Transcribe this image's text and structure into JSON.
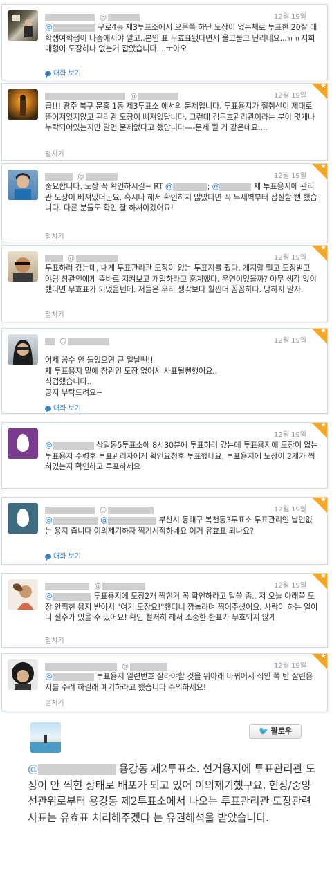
{
  "tweets": [
    {
      "time": "12월 19일",
      "text": "구로4동 제3투표소에서 오른쪽 하단 도장이 없는채로 투표한 20살 대학생여학생이 나중에서야 알고..본인 표 무효표됐다면서 울고불고 난리네요...ㅠㅠ저희 매형이 도장하나 없는거 잡았습니다....ㅜ아오",
      "action": "대화 보기"
    },
    {
      "time": "12월 19일",
      "text": "급!!! 광주 북구 문흥 1동 제3투표소 에서의 문제입니다. 투표용지가 절취선이 제대로 뜯어져있지않고 관리관 도장이 빠져있답니다. 그런데 김두호관리관이라는 분이 몇개나 누락되어있는지만 알면 문제없다고 했답니다----문제 될 거 같은데요....",
      "action": "펼치기"
    },
    {
      "time": "12월 19일",
      "prefix": "중요합니다. 도장 꼭 확인하시길~ RT",
      "text": "제 투표용지에 관리관 도장이 빠져있더군요. 혹시나 해서 확인하지 않았다면 꼭 두새벽부터 삽질할 뻔 했습니다. 다른 분들도 확인 잘 하셔야겠어요!",
      "action": "펼치기"
    },
    {
      "time": "12월 19일",
      "text": "투표하러 갔는데, 내게 투표관리관 도장이 없는 투표지를 줬다. 개지랄 떨고 도장받고 야당 참관인에게 똑바로 지켜보고 개입하라고 훈계했다. 우연이었을까? 아무 생각 없이 했다면 무효표가 되었을텐데. 저들은 우리 생각보다 훨씬더 꼼꼼하다. 당하지 말자.",
      "action": "펼치기"
    },
    {
      "time": "12월 19일",
      "lines": [
        "어제 꼼수 안 들었으면 큰 일날뻔!!",
        "제 투표용지 밑에 참관인 도장 없어서 사표될뻔했어요..",
        "식겁했습니다..",
        "공지 부탁드려요~"
      ],
      "action": "대화 보기"
    },
    {
      "time": "12월 19일",
      "text": "상일동5투표소에 8시30분에 투표하러 갔는데 투표용지에 도장이 없는 투표용지 수령후 투표관리자에게 확인요청후 투표했네요, 투표용지에 도장이 2개가 찍혀있는지 확인하고 투표하세요",
      "action": ""
    },
    {
      "time": "12월 19일",
      "text": "부산시 동래구 복천동3투표소  투표관리인 날인없는 용지 줍니다 이의제기하자 찍기시작하네요 이거 유효표 되나요?",
      "action": "대화 보기"
    },
    {
      "time": "12월 19일",
      "text": "투표용지에 도장2개 찍힌거 꼭 확인하라고 말씀 좀..  저 오늘 아래쪽 도장 안찍힌 용지 받아서  \"여기 도장요!\"했더니 깜놀라며 찍어주셨어요. 사람이 하는 일이니 실수가 있을 수 있어요! 확인 철저히 해서 소중한 한표가 무효되지 않게",
      "action": "펼치기"
    },
    {
      "time": "12월 19일",
      "text": "투표용지 일련번호 잘라야할 것을 위아래 바뀌어서 직인 쪽 반 잘린용지를 주려 하길래 폐기하라고 했습니다 주의하세요!",
      "action": "펼치기"
    }
  ],
  "footer": {
    "follow_label": "팔로우",
    "text": "용강동 제2투표소. 선거용지에 투표관리관 도장이 안 찍힌 상태로 배포가 되고 있어 이의제기했구요. 현장/중앙선관위로부터 용강동 제2투표소에서 나오는 투표관리관 도장관련 사표는 유효표 처리해주겠다 는 유권해석을 받았습니다."
  },
  "colors": {
    "link": "#3a7ec0",
    "favorite": "#f5a623",
    "border": "#cfd9e4"
  }
}
